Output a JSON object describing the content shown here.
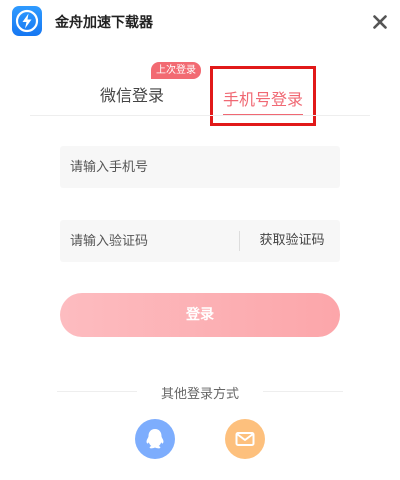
{
  "app": {
    "title": "金舟加速下载器",
    "logo_icon": "lightning-bolt-icon",
    "brand_color": "#1a85f5"
  },
  "titlebar": {
    "close_icon": "close-icon"
  },
  "tabs": [
    {
      "label": "微信登录",
      "active": false,
      "badge": "上次登录"
    },
    {
      "label": "手机号登录",
      "active": true
    }
  ],
  "phone_field": {
    "placeholder": "请输入手机号",
    "value": ""
  },
  "code_field": {
    "placeholder": "请输入验证码",
    "value": "",
    "get_code_label": "获取验证码"
  },
  "login_button": {
    "label": "登录",
    "color": "#fdb0b4"
  },
  "other_login": {
    "title": "其他登录方式",
    "methods": [
      {
        "icon": "qq-penguin-icon",
        "color": "#7dadfd"
      },
      {
        "icon": "mail-icon",
        "color": "#fdc07d"
      }
    ]
  },
  "colors": {
    "accent": "#f06873",
    "highlight_border": "#e11919",
    "badge": "#f26a72"
  }
}
